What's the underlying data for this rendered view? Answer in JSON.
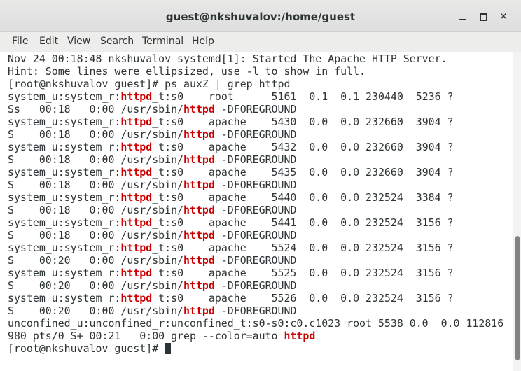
{
  "window": {
    "title": "guest@nkshuvalov:/home/guest"
  },
  "icons": {
    "minimize": "minimize-icon",
    "maximize": "maximize-icon",
    "close": "close-icon",
    "close_glyph": "✕"
  },
  "menu": [
    {
      "label": "File"
    },
    {
      "label": "Edit"
    },
    {
      "label": "View"
    },
    {
      "label": "Search"
    },
    {
      "label": "Terminal"
    },
    {
      "label": "Help"
    }
  ],
  "highlight_color": "#cc0000",
  "terminal": {
    "lines": [
      [
        {
          "t": "Nov 24 00:18:48 nkshuvalov systemd[1]: Started The Apache HTTP Server."
        }
      ],
      [
        {
          "t": "Hint: Some lines were ellipsized, use -l to show in full."
        }
      ],
      [
        {
          "t": "[root@nkshuvalov guest]# ps auxZ | grep httpd"
        }
      ],
      [
        {
          "t": "system_u:system_r:"
        },
        {
          "t": "httpd",
          "hl": true
        },
        {
          "t": "_t:s0    root      5161  0.1  0.1 230440  5236 ?"
        }
      ],
      [
        {
          "t": "Ss   00:18   0:00 /usr/sbin/"
        },
        {
          "t": "httpd",
          "hl": true
        },
        {
          "t": " -DFOREGROUND"
        }
      ],
      [
        {
          "t": "system_u:system_r:"
        },
        {
          "t": "httpd",
          "hl": true
        },
        {
          "t": "_t:s0    apache    5430  0.0  0.0 232660  3904 ?"
        }
      ],
      [
        {
          "t": "S    00:18   0:00 /usr/sbin/"
        },
        {
          "t": "httpd",
          "hl": true
        },
        {
          "t": " -DFOREGROUND"
        }
      ],
      [
        {
          "t": "system_u:system_r:"
        },
        {
          "t": "httpd",
          "hl": true
        },
        {
          "t": "_t:s0    apache    5432  0.0  0.0 232660  3904 ?"
        }
      ],
      [
        {
          "t": "S    00:18   0:00 /usr/sbin/"
        },
        {
          "t": "httpd",
          "hl": true
        },
        {
          "t": " -DFOREGROUND"
        }
      ],
      [
        {
          "t": "system_u:system_r:"
        },
        {
          "t": "httpd",
          "hl": true
        },
        {
          "t": "_t:s0    apache    5435  0.0  0.0 232660  3904 ?"
        }
      ],
      [
        {
          "t": "S    00:18   0:00 /usr/sbin/"
        },
        {
          "t": "httpd",
          "hl": true
        },
        {
          "t": " -DFOREGROUND"
        }
      ],
      [
        {
          "t": "system_u:system_r:"
        },
        {
          "t": "httpd",
          "hl": true
        },
        {
          "t": "_t:s0    apache    5440  0.0  0.0 232524  3384 ?"
        }
      ],
      [
        {
          "t": "S    00:18   0:00 /usr/sbin/"
        },
        {
          "t": "httpd",
          "hl": true
        },
        {
          "t": " -DFOREGROUND"
        }
      ],
      [
        {
          "t": "system_u:system_r:"
        },
        {
          "t": "httpd",
          "hl": true
        },
        {
          "t": "_t:s0    apache    5441  0.0  0.0 232524  3156 ?"
        }
      ],
      [
        {
          "t": "S    00:18   0:00 /usr/sbin/"
        },
        {
          "t": "httpd",
          "hl": true
        },
        {
          "t": " -DFOREGROUND"
        }
      ],
      [
        {
          "t": "system_u:system_r:"
        },
        {
          "t": "httpd",
          "hl": true
        },
        {
          "t": "_t:s0    apache    5524  0.0  0.0 232524  3156 ?"
        }
      ],
      [
        {
          "t": "S    00:20   0:00 /usr/sbin/"
        },
        {
          "t": "httpd",
          "hl": true
        },
        {
          "t": " -DFOREGROUND"
        }
      ],
      [
        {
          "t": "system_u:system_r:"
        },
        {
          "t": "httpd",
          "hl": true
        },
        {
          "t": "_t:s0    apache    5525  0.0  0.0 232524  3156 ?"
        }
      ],
      [
        {
          "t": "S    00:20   0:00 /usr/sbin/"
        },
        {
          "t": "httpd",
          "hl": true
        },
        {
          "t": " -DFOREGROUND"
        }
      ],
      [
        {
          "t": "system_u:system_r:"
        },
        {
          "t": "httpd",
          "hl": true
        },
        {
          "t": "_t:s0    apache    5526  0.0  0.0 232524  3156 ?"
        }
      ],
      [
        {
          "t": "S    00:20   0:00 /usr/sbin/"
        },
        {
          "t": "httpd",
          "hl": true
        },
        {
          "t": " -DFOREGROUND"
        }
      ],
      [
        {
          "t": "unconfined_u:unconfined_r:unconfined_t:s0-s0:c0.c1023 root 5538 0.0  0.0 112816"
        }
      ],
      [
        {
          "t": "980 pts/0 S+ 00:21   0:00 grep --color=auto "
        },
        {
          "t": "httpd",
          "hl": true
        }
      ],
      [
        {
          "t": "[root@nkshuvalov guest]# "
        },
        {
          "cursor": true
        }
      ]
    ]
  }
}
